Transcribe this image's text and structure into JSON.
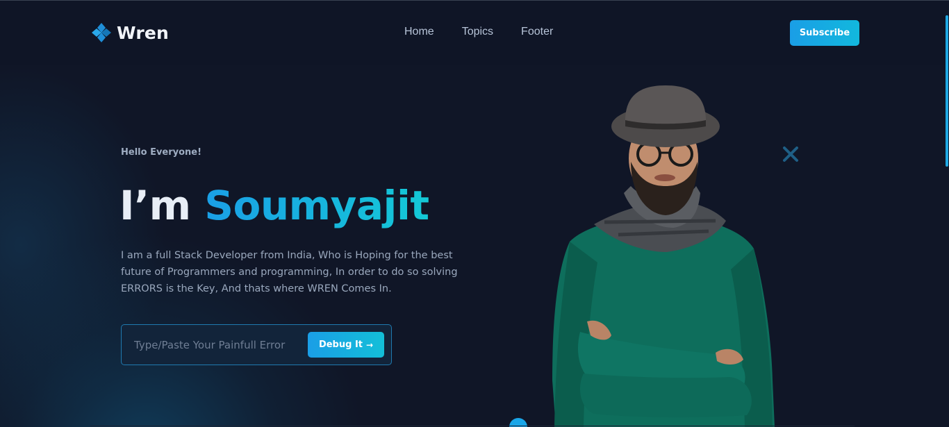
{
  "brand": {
    "name": "Wren",
    "logo_icon": "pinwheel-icon",
    "colors": {
      "accent": "#1a9ee6",
      "accent_2": "#14c9d6",
      "background": "#101627"
    }
  },
  "nav": {
    "items": [
      {
        "label": "Home"
      },
      {
        "label": "Topics"
      },
      {
        "label": "Footer"
      }
    ]
  },
  "header": {
    "subscribe_label": "Subscribe"
  },
  "hero": {
    "greeting": "Hello Everyone!",
    "headline_prefix": "I’m",
    "headline_name": "Soumyajit",
    "description": "I am a full Stack Developer from India, Who is Hoping for the best future of Programmers and programming, In order to do so solving ERRORS is the Key, And thats where WREN Comes In.",
    "search": {
      "placeholder": "Type/Paste Your Painfull Error",
      "value": ""
    },
    "debug_button_label": "Debug It",
    "debug_button_icon": "arrow-right-icon",
    "decor_icon": "close-icon",
    "portrait_icon": "person-portrait"
  }
}
